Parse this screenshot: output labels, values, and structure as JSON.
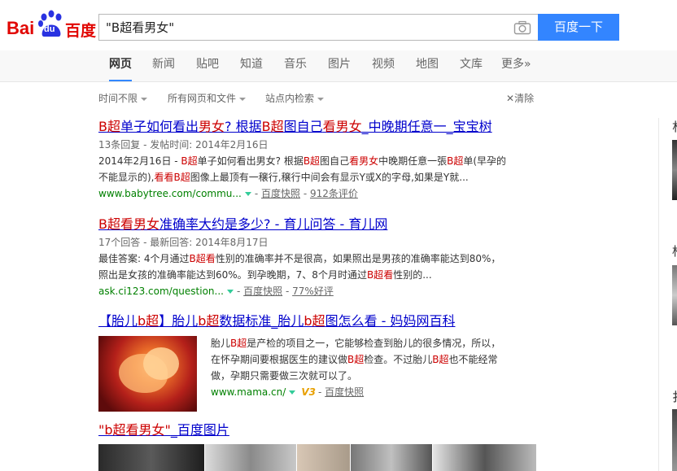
{
  "logo": {
    "text_bai": "Bai",
    "text_du": "du",
    "text_cn": "百度"
  },
  "search": {
    "query": "\"B超看男女\"",
    "button_label": "百度一下"
  },
  "tabs": [
    "网页",
    "新闻",
    "贴吧",
    "知道",
    "音乐",
    "图片",
    "视频",
    "地图",
    "文库",
    "更多»"
  ],
  "filters": {
    "time": "时间不限",
    "type": "所有网页和文件",
    "site": "站点内检索",
    "clear": "清除"
  },
  "results": [
    {
      "title_parts": [
        "B超",
        "单子如何看出",
        "男女",
        "? 根据",
        "B超",
        "图自己",
        "看男女",
        "_中晚期任意一_宝宝树"
      ],
      "meta": "13条回复 - 发帖时间: 2014年2月16日",
      "abstract_line1": [
        "2014年2月16日 - ",
        "B超",
        "单子如何看出男女? 根据",
        "B超",
        "图自己",
        "看男女",
        "中晚期任意一張",
        "B超",
        "单(早孕的"
      ],
      "abstract_line2": [
        "不能显示的),",
        "看看",
        "B超",
        "图像上最顶有一穣行,穣行中间会有显示Y或X的字母,如果是Y就..."
      ],
      "url": "www.babytree.com/commu...",
      "cache": "百度快照",
      "extra": "912条评价"
    },
    {
      "title_parts": [
        "B超",
        "看男女",
        "准确率大约是多少? - 育儿问答 - 育儿网"
      ],
      "meta": "17个回答 - 最新回答: 2014年8月17日",
      "abstract_line1": [
        "最佳答案: 4个月通过",
        "B超",
        "看",
        "性别的准确率并不是很高，如果照出是男孩的准确率能达到80%，"
      ],
      "abstract_line2": [
        "照出是女孩的准确率能达到60%。到孕晚期，7、8个月时通过",
        "B超",
        "看",
        "性别的..."
      ],
      "url": "ask.ci123.com/question...",
      "cache": "百度快照",
      "extra": "77%好评"
    },
    {
      "title_parts": [
        "【胎儿",
        "b超",
        "】胎儿",
        "b超",
        "数据标准_胎儿",
        "b超",
        "图怎么看 - 妈妈网百科"
      ],
      "abstract_line1": [
        "胎儿",
        "B超",
        "是产检的项目之一，它能够检查到胎儿的很多情况，所以，"
      ],
      "abstract_line2": [
        "在怀孕期间要根据医生的建议做",
        "B超",
        "检查。不过胎儿",
        "B超",
        "也不能经常"
      ],
      "abstract_line3": "做，孕期只需要做三次就可以了。",
      "url": "www.mama.cn/",
      "v3": "V3",
      "cache": "百度快照"
    }
  ],
  "image_result": {
    "title_parts": [
      "\"b超看男女\"",
      "_百度图片"
    ]
  },
  "right_chars": [
    "朴",
    "柞",
    "扌"
  ],
  "colors": {
    "accent": "#3385ff",
    "link": "#0000cc",
    "highlight": "#cc0000",
    "url": "#008000"
  }
}
